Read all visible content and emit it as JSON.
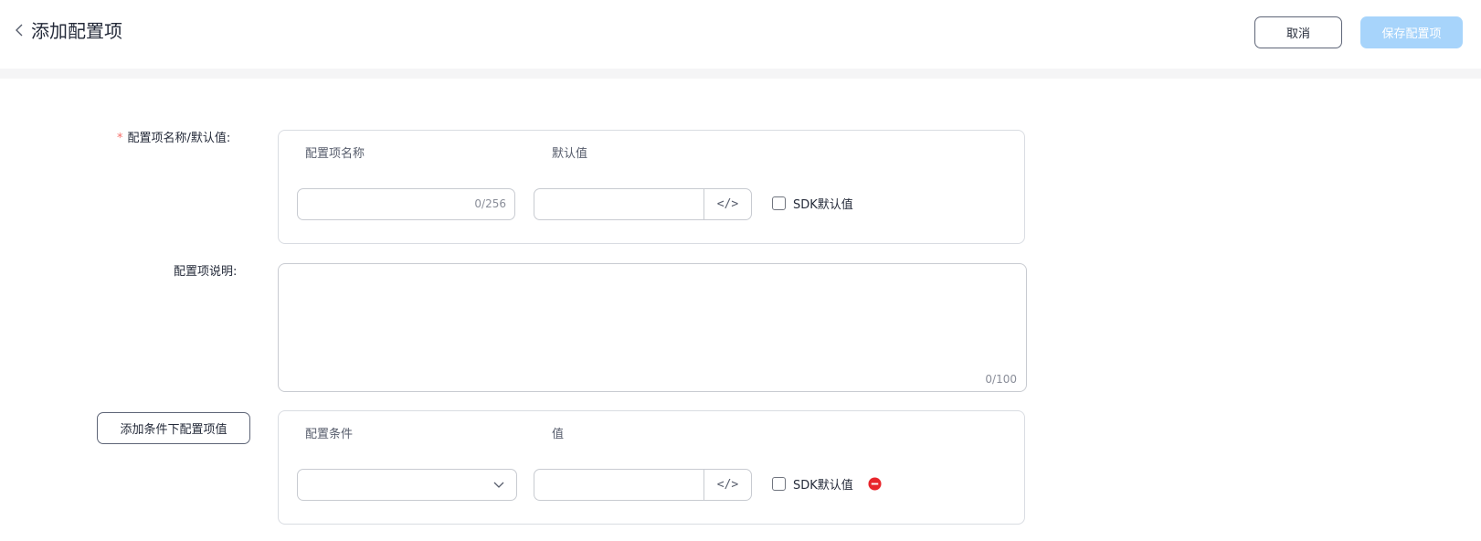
{
  "header": {
    "back_icon": "chevron-left-icon",
    "title": "添加配置项",
    "cancel_label": "取消",
    "save_label": "保存配置项"
  },
  "form": {
    "name_default_label": "配置项名称/默认值:",
    "required_mark": "*",
    "name_col_label": "配置项名称",
    "default_col_label": "默认值",
    "name_input_value": "",
    "name_counter": "0/256",
    "default_input_value": "",
    "code_icon_text": "</>",
    "sdk_default_label": "SDK默认值",
    "description_label": "配置项说明:",
    "description_value": "",
    "description_counter": "0/100",
    "add_condition_label": "添加条件下配置项值",
    "condition": {
      "condition_col_label": "配置条件",
      "value_col_label": "值",
      "selected_condition": "",
      "value_input": "",
      "code_icon_text": "</>",
      "sdk_default_label": "SDK默认值",
      "remove_icon": "minus-circle-icon"
    }
  },
  "colors": {
    "primary_disabled": "#a7d4fb",
    "required": "#f66f6a",
    "danger": "#e8252b",
    "border": "#c8cbd1"
  }
}
